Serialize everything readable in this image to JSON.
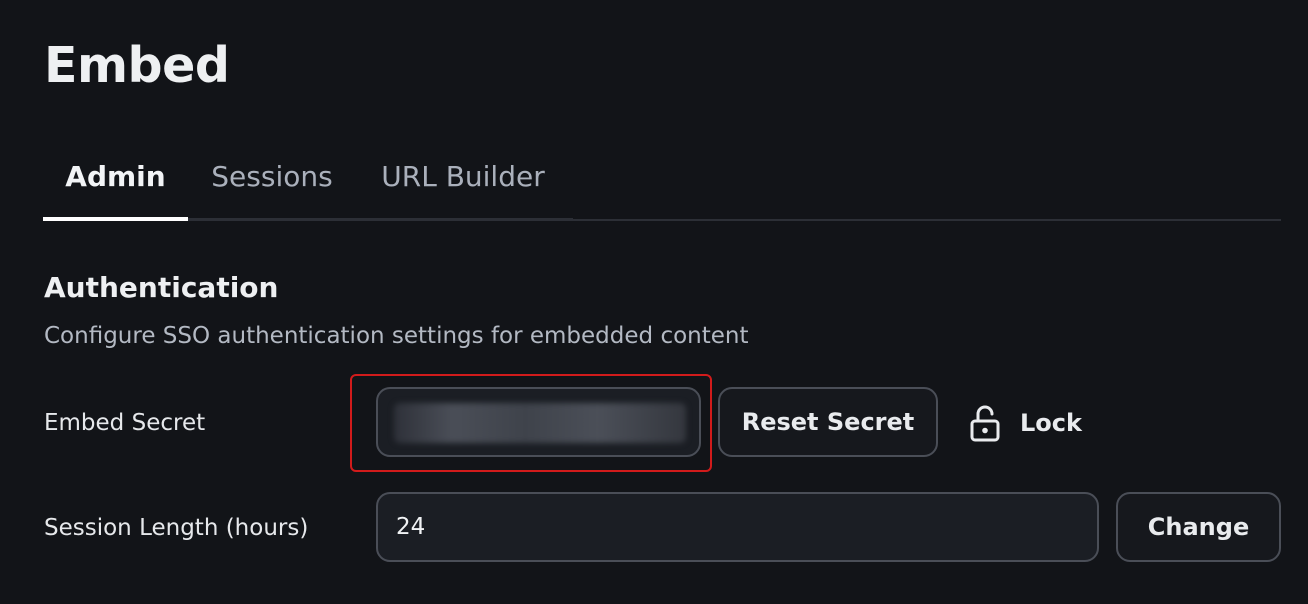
{
  "page": {
    "title": "Embed"
  },
  "tabs": [
    {
      "label": "Admin",
      "active": true
    },
    {
      "label": "Sessions",
      "active": false
    },
    {
      "label": "URL Builder",
      "active": false
    }
  ],
  "section": {
    "title": "Authentication",
    "description": "Configure SSO authentication settings for embedded content"
  },
  "embed_secret": {
    "label": "Embed Secret",
    "value_obscured": true,
    "reset_button": "Reset Secret",
    "lock_button": "Lock",
    "lock_icon": "unlocked-padlock-icon"
  },
  "session_length": {
    "label": "Session Length (hours)",
    "value": "24",
    "change_button": "Change"
  },
  "colors": {
    "background": "#121418",
    "field_background": "#1b1e24",
    "border": "#4a4e57",
    "highlight": "#d11b1b",
    "active_tab_underline": "#ffffff"
  }
}
